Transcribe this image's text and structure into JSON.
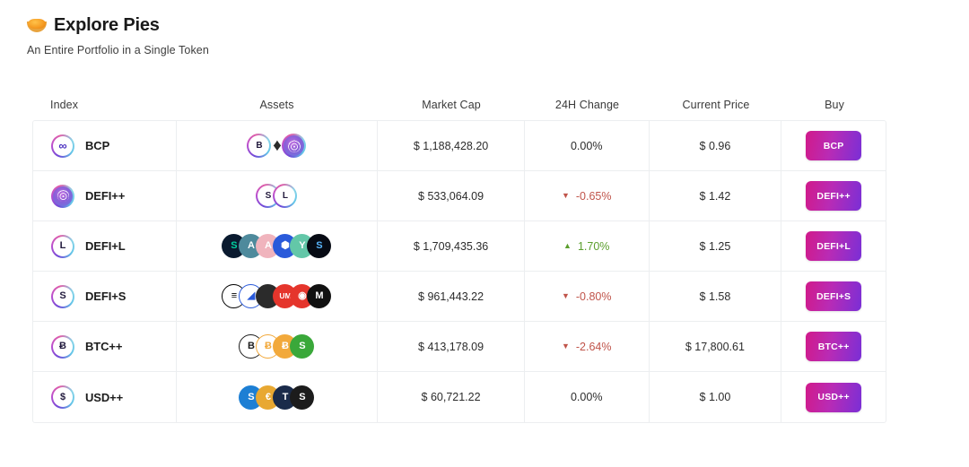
{
  "header": {
    "emoji": "pie-emoji",
    "title": "Explore Pies",
    "subtitle": "An Entire Portfolio in a Single Token"
  },
  "table": {
    "columns": [
      "Index",
      "Assets",
      "Market Cap",
      "24H Change",
      "Current Price",
      "Buy"
    ],
    "rows": [
      {
        "index_symbol": "BCP",
        "index_icon": "infinity-icon",
        "assets": [
          {
            "symbol": "B",
            "icon": "btc-plus-plus-token",
            "style": "ring-dark"
          },
          {
            "symbol": "E",
            "icon": "eth-token",
            "style": "eth"
          },
          {
            "symbol": "",
            "icon": "defi-plus-plus-token",
            "style": "ring-fingerprint"
          }
        ],
        "market_cap": "$ 1,188,428.20",
        "change": "0.00%",
        "change_dir": "flat",
        "price": "$ 0.96",
        "buy_label": "BCP"
      },
      {
        "index_symbol": "DEFI++",
        "index_icon": "fingerprint-icon",
        "assets": [
          {
            "symbol": "S",
            "icon": "defi-s-token",
            "style": "ring"
          },
          {
            "symbol": "L",
            "icon": "defi-l-token",
            "style": "ring"
          }
        ],
        "market_cap": "$ 533,064.09",
        "change": "-0.65%",
        "change_dir": "down",
        "price": "$ 1.42",
        "buy_label": "DEFI++"
      },
      {
        "index_symbol": "DEFI+L",
        "index_icon": "letter-l-icon",
        "assets": [
          {
            "symbol": "S",
            "icon": "snx-token",
            "color": "#00d1a0",
            "bg": "#0a1a2f"
          },
          {
            "symbol": "A",
            "icon": "aave-token",
            "color": "#ffffff",
            "bg": "#4e8a9c"
          },
          {
            "symbol": "A",
            "icon": "aragon-token",
            "color": "#ffffff",
            "bg": "#f0b4bd"
          },
          {
            "symbol": "⬢",
            "icon": "chainlink-token",
            "color": "#ffffff",
            "bg": "#2a5ada"
          },
          {
            "symbol": "Y",
            "icon": "yearn-token",
            "color": "#ffffff",
            "bg": "#63c7a8"
          },
          {
            "symbol": "S",
            "icon": "sushi-token",
            "color": "#5ab7ff",
            "bg": "#070b14"
          }
        ],
        "market_cap": "$ 1,709,435.36",
        "change": "1.70%",
        "change_dir": "up",
        "price": "$ 1.25",
        "buy_label": "DEFI+L"
      },
      {
        "index_symbol": "DEFI+S",
        "index_icon": "letter-s-icon",
        "assets": [
          {
            "symbol": "≡",
            "icon": "balancer-token",
            "color": "#000000",
            "bg": "#ffffff"
          },
          {
            "symbol": "◢",
            "icon": "aragon-court-token",
            "color": "#2a5ada",
            "bg": "#ffffff"
          },
          {
            "symbol": "",
            "icon": "loopring-token",
            "color": "#ffffff",
            "bg": "#2b2b2b"
          },
          {
            "symbol": "UM",
            "icon": "uma-token",
            "color": "#ffffff",
            "bg": "#e5352c"
          },
          {
            "symbol": "◉",
            "icon": "kyber-token",
            "color": "#ffffff",
            "bg": "#e5352c"
          },
          {
            "symbol": "M",
            "icon": "maker-token",
            "color": "#ffffff",
            "bg": "#111111"
          }
        ],
        "market_cap": "$ 961,443.22",
        "change": "-0.80%",
        "change_dir": "down",
        "price": "$ 1.58",
        "buy_label": "DEFI+S"
      },
      {
        "index_symbol": "BTC++",
        "index_icon": "bitcoin-icon",
        "assets": [
          {
            "symbol": "B",
            "icon": "bitcoin-black-token",
            "color": "#1c1c1c",
            "bg": "#ffffff"
          },
          {
            "symbol": "Ƀ",
            "icon": "wbtc-token",
            "color": "#f2a93b",
            "bg": "#ffffff"
          },
          {
            "symbol": "Ƀ",
            "icon": "imbtc-token",
            "color": "#ffffff",
            "bg": "#f2a93b"
          },
          {
            "symbol": "S",
            "icon": "sbtc-token",
            "color": "#ffffff",
            "bg": "#3aa83a"
          }
        ],
        "market_cap": "$ 413,178.09",
        "change": "-2.64%",
        "change_dir": "down",
        "price": "$ 17,800.61",
        "buy_label": "BTC++"
      },
      {
        "index_symbol": "USD++",
        "index_icon": "dollar-icon",
        "assets": [
          {
            "symbol": "S",
            "icon": "susd-token",
            "color": "#ffffff",
            "bg": "#1d7fd4"
          },
          {
            "symbol": "€",
            "icon": "eurs-token",
            "color": "#ffffff",
            "bg": "#e8a832"
          },
          {
            "symbol": "T",
            "icon": "tusd-token",
            "color": "#ffffff",
            "bg": "#1a2b4a"
          },
          {
            "symbol": "S",
            "icon": "usdc-token",
            "color": "#ffffff",
            "bg": "#1c1c1c"
          }
        ],
        "market_cap": "$ 60,721.22",
        "change": "0.00%",
        "change_dir": "flat",
        "price": "$ 1.00",
        "buy_label": "USD++"
      }
    ]
  },
  "colors": {
    "up": "#5b9e2d",
    "down": "#c0544a",
    "flat": "#2b2b2b",
    "button_gradient_from": "#d11a8a",
    "button_gradient_to": "#7a2fd6",
    "border": "#eceef0"
  },
  "symbols": {
    "arrow_up": "▲",
    "arrow_down": "▼",
    "infinity": "∞"
  }
}
